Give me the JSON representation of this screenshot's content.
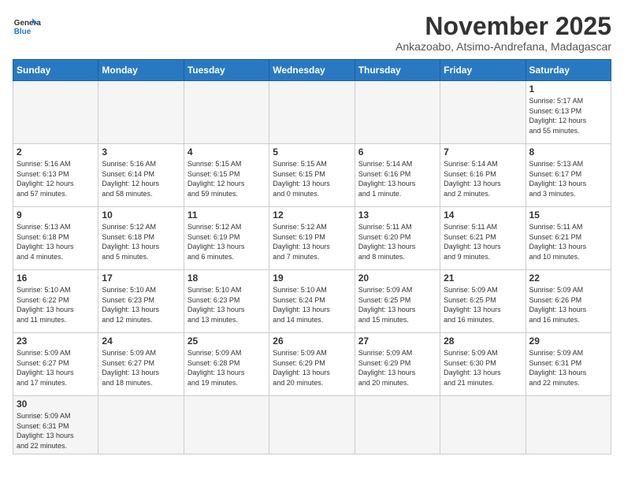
{
  "header": {
    "logo_line1": "General",
    "logo_line2": "Blue",
    "month": "November 2025",
    "location": "Ankazoabo, Atsimo-Andrefana, Madagascar"
  },
  "days_of_week": [
    "Sunday",
    "Monday",
    "Tuesday",
    "Wednesday",
    "Thursday",
    "Friday",
    "Saturday"
  ],
  "weeks": [
    [
      {
        "day": "",
        "info": ""
      },
      {
        "day": "",
        "info": ""
      },
      {
        "day": "",
        "info": ""
      },
      {
        "day": "",
        "info": ""
      },
      {
        "day": "",
        "info": ""
      },
      {
        "day": "",
        "info": ""
      },
      {
        "day": "1",
        "info": "Sunrise: 5:17 AM\nSunset: 6:13 PM\nDaylight: 12 hours\nand 55 minutes."
      }
    ],
    [
      {
        "day": "2",
        "info": "Sunrise: 5:16 AM\nSunset: 6:13 PM\nDaylight: 12 hours\nand 57 minutes."
      },
      {
        "day": "3",
        "info": "Sunrise: 5:16 AM\nSunset: 6:14 PM\nDaylight: 12 hours\nand 58 minutes."
      },
      {
        "day": "4",
        "info": "Sunrise: 5:15 AM\nSunset: 6:15 PM\nDaylight: 12 hours\nand 59 minutes."
      },
      {
        "day": "5",
        "info": "Sunrise: 5:15 AM\nSunset: 6:15 PM\nDaylight: 13 hours\nand 0 minutes."
      },
      {
        "day": "6",
        "info": "Sunrise: 5:14 AM\nSunset: 6:16 PM\nDaylight: 13 hours\nand 1 minute."
      },
      {
        "day": "7",
        "info": "Sunrise: 5:14 AM\nSunset: 6:16 PM\nDaylight: 13 hours\nand 2 minutes."
      },
      {
        "day": "8",
        "info": "Sunrise: 5:13 AM\nSunset: 6:17 PM\nDaylight: 13 hours\nand 3 minutes."
      }
    ],
    [
      {
        "day": "9",
        "info": "Sunrise: 5:13 AM\nSunset: 6:18 PM\nDaylight: 13 hours\nand 4 minutes."
      },
      {
        "day": "10",
        "info": "Sunrise: 5:12 AM\nSunset: 6:18 PM\nDaylight: 13 hours\nand 5 minutes."
      },
      {
        "day": "11",
        "info": "Sunrise: 5:12 AM\nSunset: 6:19 PM\nDaylight: 13 hours\nand 6 minutes."
      },
      {
        "day": "12",
        "info": "Sunrise: 5:12 AM\nSunset: 6:19 PM\nDaylight: 13 hours\nand 7 minutes."
      },
      {
        "day": "13",
        "info": "Sunrise: 5:11 AM\nSunset: 6:20 PM\nDaylight: 13 hours\nand 8 minutes."
      },
      {
        "day": "14",
        "info": "Sunrise: 5:11 AM\nSunset: 6:21 PM\nDaylight: 13 hours\nand 9 minutes."
      },
      {
        "day": "15",
        "info": "Sunrise: 5:11 AM\nSunset: 6:21 PM\nDaylight: 13 hours\nand 10 minutes."
      }
    ],
    [
      {
        "day": "16",
        "info": "Sunrise: 5:10 AM\nSunset: 6:22 PM\nDaylight: 13 hours\nand 11 minutes."
      },
      {
        "day": "17",
        "info": "Sunrise: 5:10 AM\nSunset: 6:23 PM\nDaylight: 13 hours\nand 12 minutes."
      },
      {
        "day": "18",
        "info": "Sunrise: 5:10 AM\nSunset: 6:23 PM\nDaylight: 13 hours\nand 13 minutes."
      },
      {
        "day": "19",
        "info": "Sunrise: 5:10 AM\nSunset: 6:24 PM\nDaylight: 13 hours\nand 14 minutes."
      },
      {
        "day": "20",
        "info": "Sunrise: 5:09 AM\nSunset: 6:25 PM\nDaylight: 13 hours\nand 15 minutes."
      },
      {
        "day": "21",
        "info": "Sunrise: 5:09 AM\nSunset: 6:25 PM\nDaylight: 13 hours\nand 16 minutes."
      },
      {
        "day": "22",
        "info": "Sunrise: 5:09 AM\nSunset: 6:26 PM\nDaylight: 13 hours\nand 16 minutes."
      }
    ],
    [
      {
        "day": "23",
        "info": "Sunrise: 5:09 AM\nSunset: 6:27 PM\nDaylight: 13 hours\nand 17 minutes."
      },
      {
        "day": "24",
        "info": "Sunrise: 5:09 AM\nSunset: 6:27 PM\nDaylight: 13 hours\nand 18 minutes."
      },
      {
        "day": "25",
        "info": "Sunrise: 5:09 AM\nSunset: 6:28 PM\nDaylight: 13 hours\nand 19 minutes."
      },
      {
        "day": "26",
        "info": "Sunrise: 5:09 AM\nSunset: 6:29 PM\nDaylight: 13 hours\nand 20 minutes."
      },
      {
        "day": "27",
        "info": "Sunrise: 5:09 AM\nSunset: 6:29 PM\nDaylight: 13 hours\nand 20 minutes."
      },
      {
        "day": "28",
        "info": "Sunrise: 5:09 AM\nSunset: 6:30 PM\nDaylight: 13 hours\nand 21 minutes."
      },
      {
        "day": "29",
        "info": "Sunrise: 5:09 AM\nSunset: 6:31 PM\nDaylight: 13 hours\nand 22 minutes."
      }
    ],
    [
      {
        "day": "30",
        "info": "Sunrise: 5:09 AM\nSunset: 6:31 PM\nDaylight: 13 hours\nand 22 minutes."
      },
      {
        "day": "",
        "info": ""
      },
      {
        "day": "",
        "info": ""
      },
      {
        "day": "",
        "info": ""
      },
      {
        "day": "",
        "info": ""
      },
      {
        "day": "",
        "info": ""
      },
      {
        "day": "",
        "info": ""
      }
    ]
  ]
}
